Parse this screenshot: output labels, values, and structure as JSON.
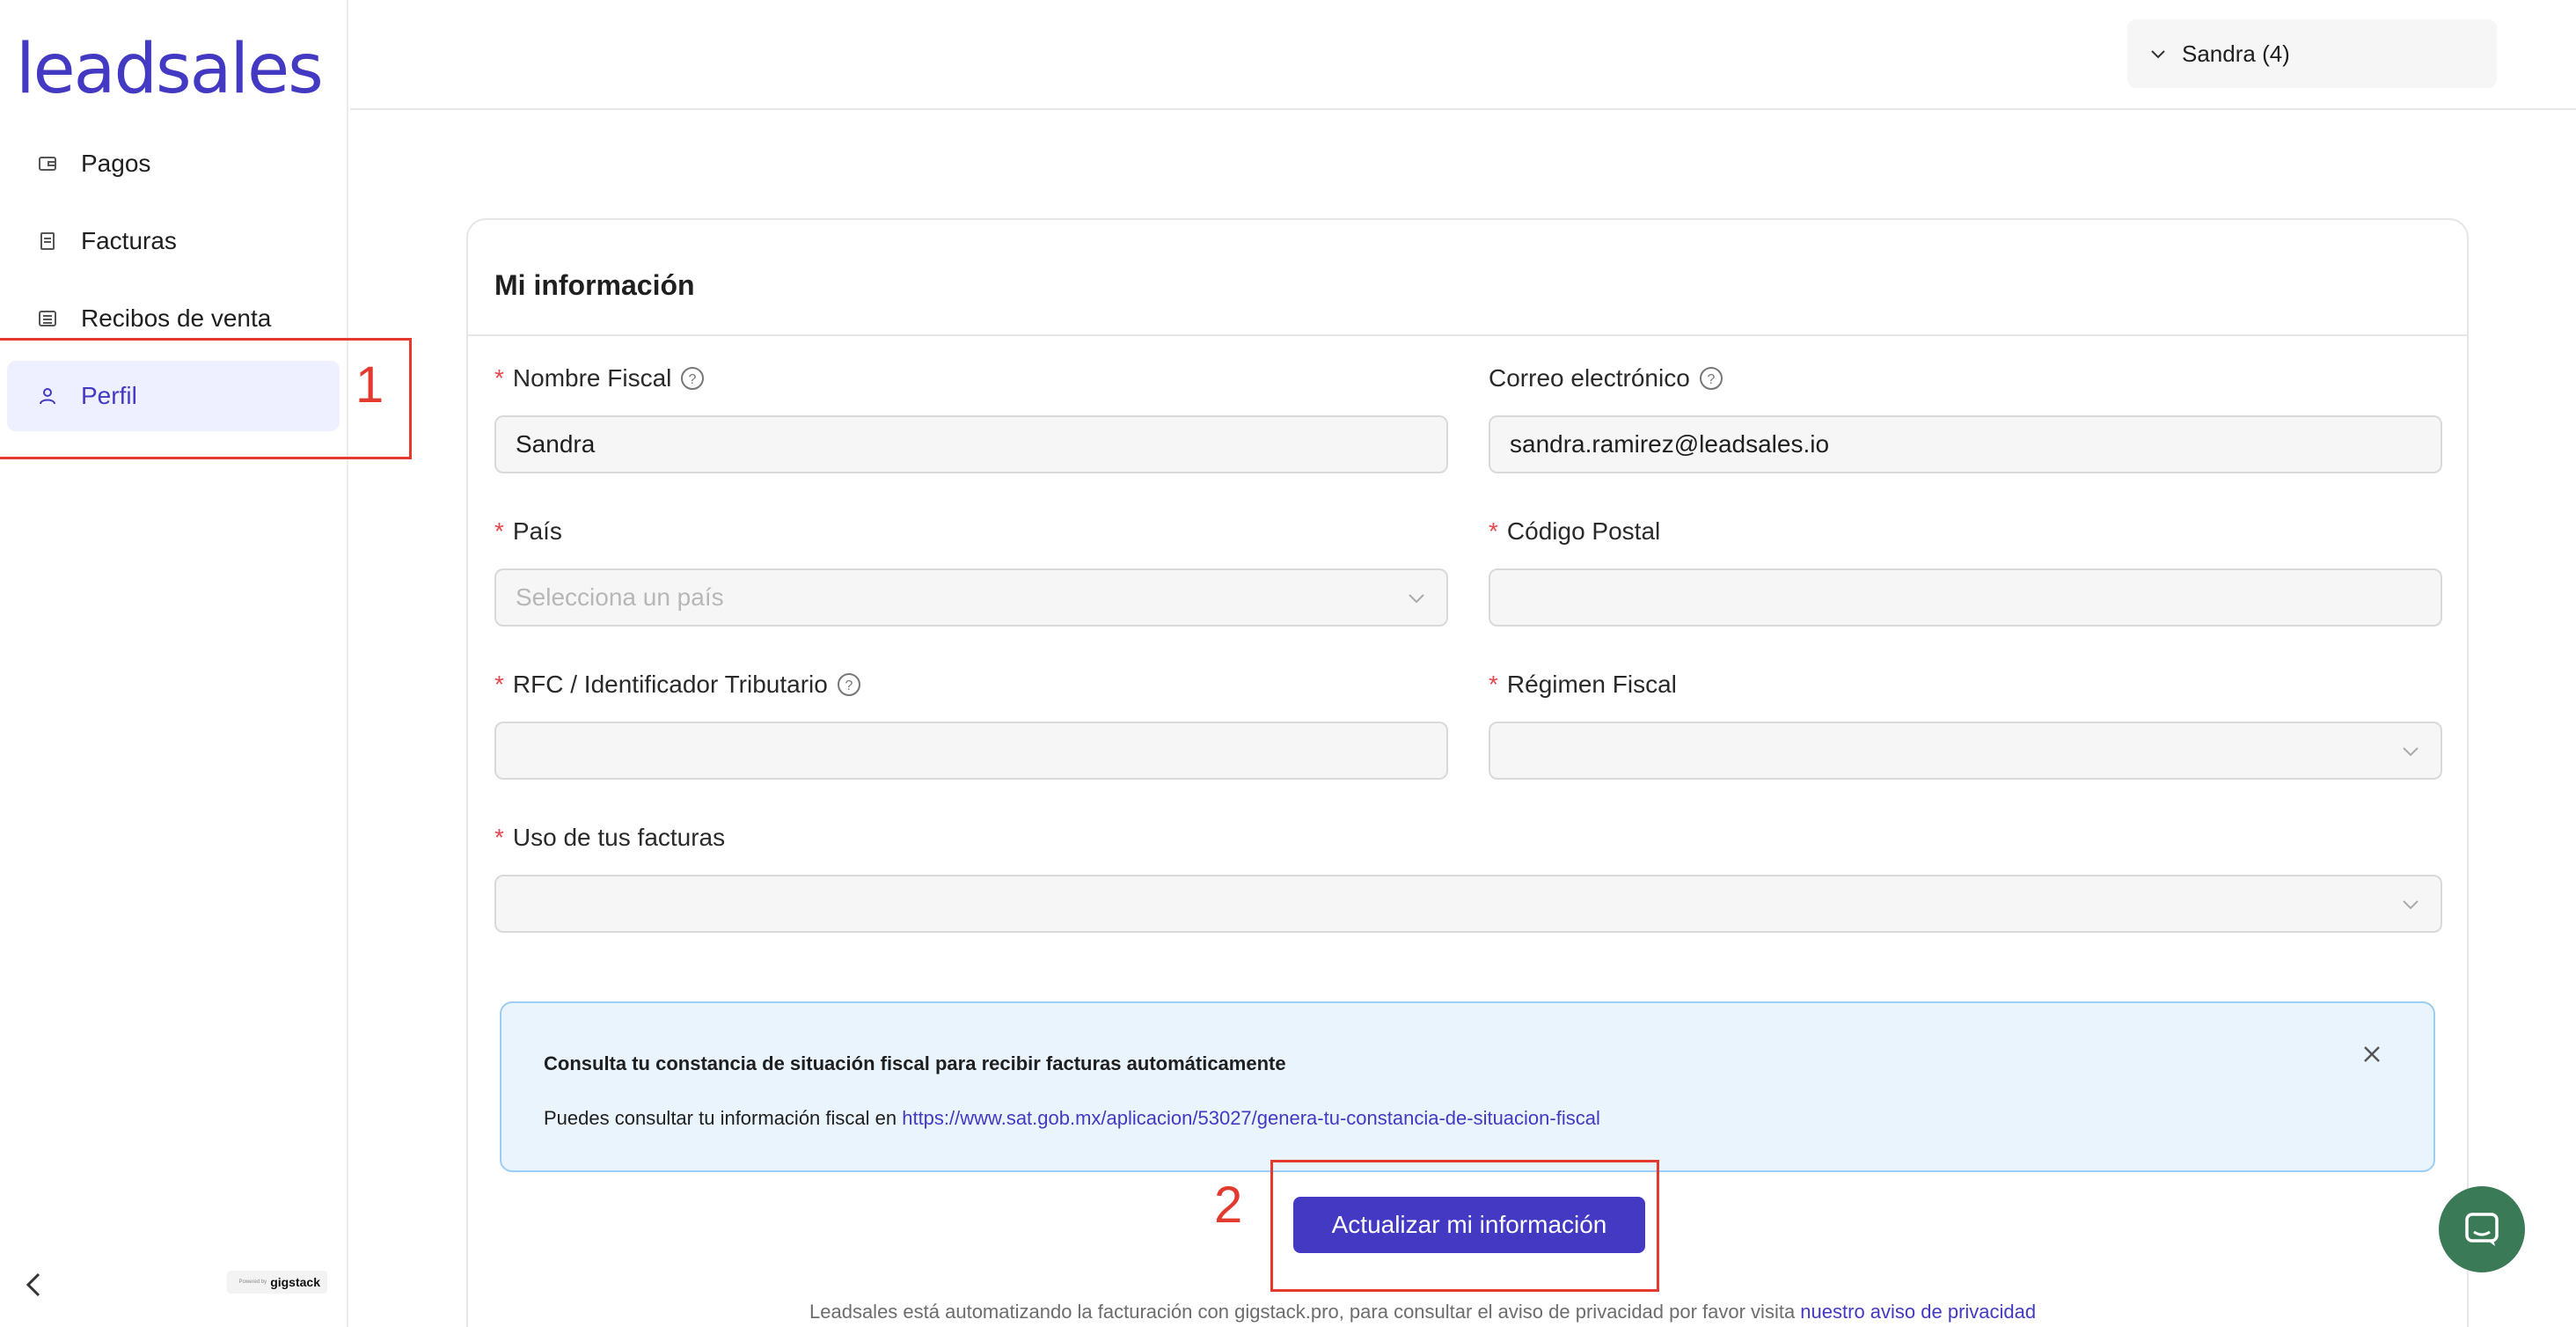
{
  "sidebar": {
    "logo": "leadsales",
    "items": [
      {
        "label": "Pagos",
        "icon": "wallet-icon"
      },
      {
        "label": "Facturas",
        "icon": "receipt-icon"
      },
      {
        "label": "Recibos de venta",
        "icon": "list-icon"
      },
      {
        "label": "Perfil",
        "icon": "user-icon",
        "active": true
      }
    ],
    "powered_small": "Powered by",
    "powered_brand": "gigstack"
  },
  "header": {
    "user": "Sandra (4)"
  },
  "card": {
    "title": "Mi información",
    "fields": {
      "nombre_fiscal": {
        "label": "Nombre Fiscal",
        "value": "Sandra"
      },
      "correo": {
        "label": "Correo electrónico",
        "value": "sandra.ramirez@leadsales.io"
      },
      "pais": {
        "label": "País",
        "placeholder": "Selecciona un país"
      },
      "codigo_postal": {
        "label": "Código Postal",
        "value": ""
      },
      "rfc": {
        "label": "RFC / Identificador Tributario",
        "value": ""
      },
      "regimen": {
        "label": "Régimen Fiscal",
        "value": ""
      },
      "uso": {
        "label": "Uso de tus facturas",
        "value": ""
      }
    },
    "alert": {
      "title": "Consulta tu constancia de situación fiscal para recibir facturas automáticamente",
      "body_prefix": "Puedes consultar tu información fiscal en ",
      "link": "https://www.sat.gob.mx/aplicacion/53027/genera-tu-constancia-de-situacion-fiscal"
    },
    "submit_label": "Actualizar mi información"
  },
  "footer": {
    "text": "Leadsales está automatizando la facturación con gigstack.pro, para consultar el aviso de privacidad por favor visita ",
    "link": "nuestro aviso de privacidad"
  },
  "annotations": {
    "one": "1",
    "two": "2"
  },
  "colors": {
    "brand": "#4339c2",
    "annotation": "#e23a2e",
    "alert_bg": "#e9f4fd",
    "chat": "#3b7a57"
  }
}
